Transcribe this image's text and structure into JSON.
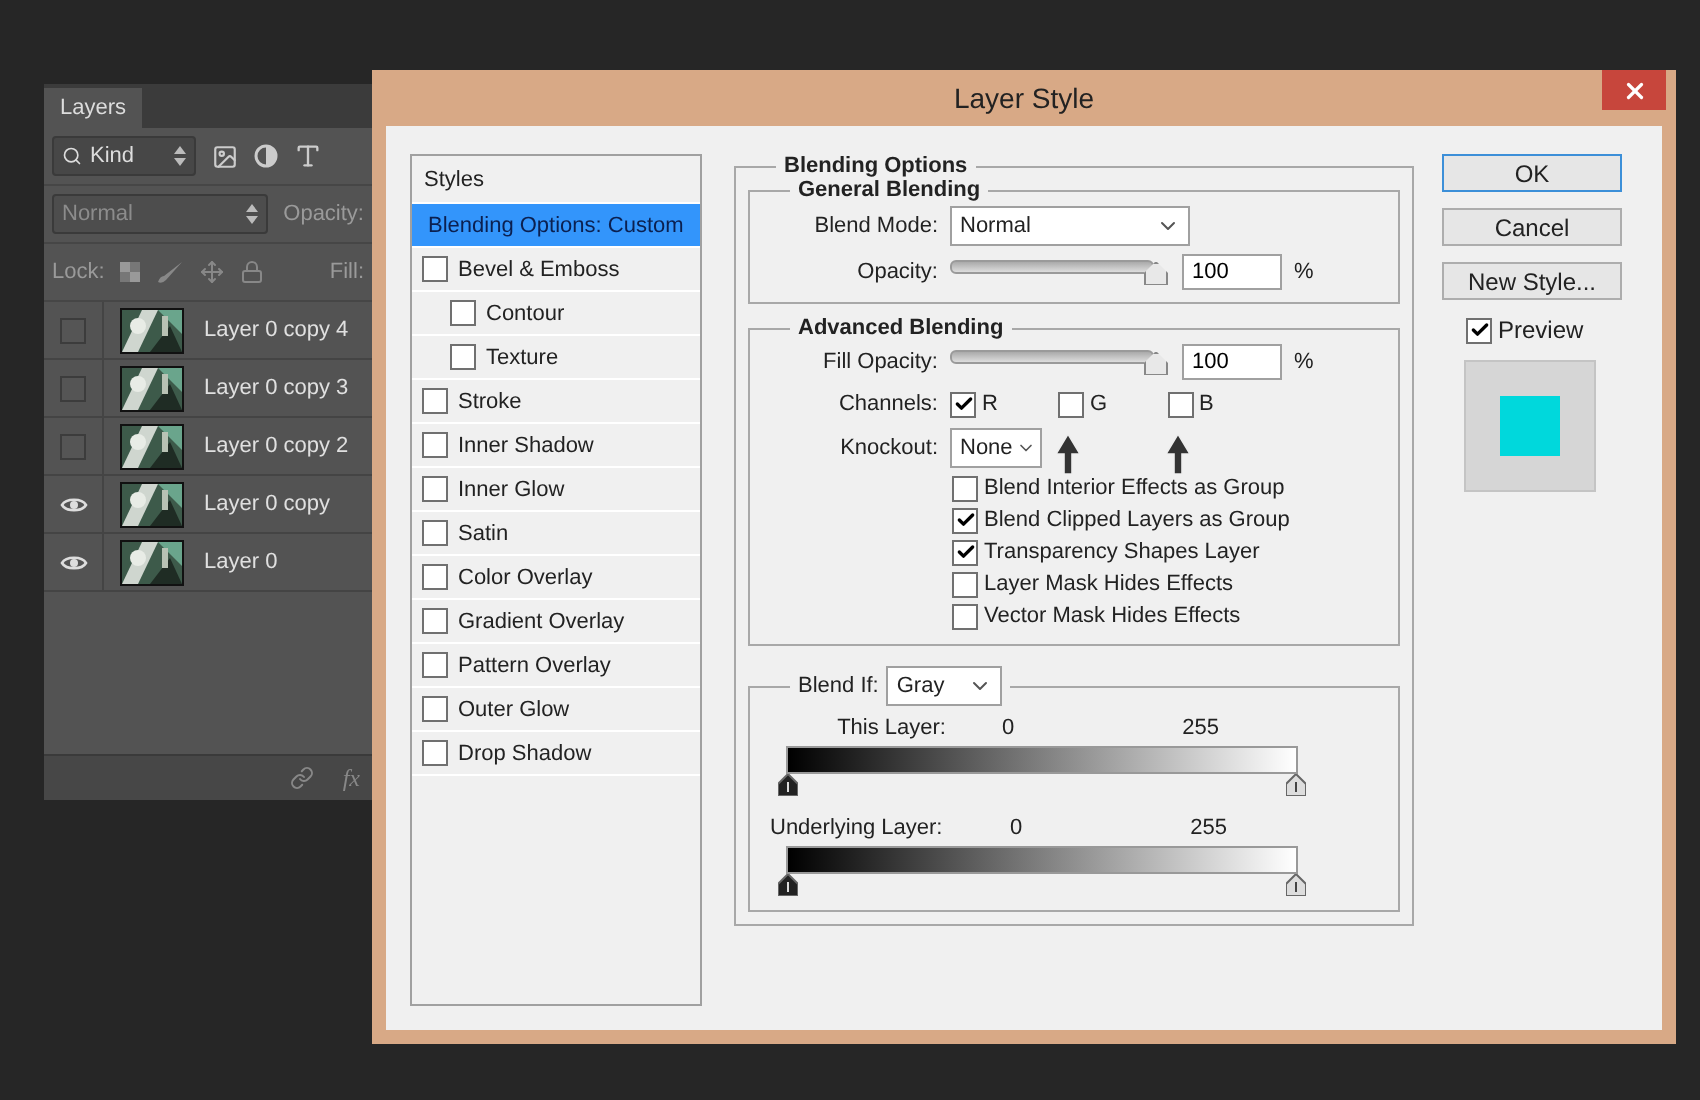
{
  "layers_panel": {
    "tab": "Layers",
    "filter": "Kind",
    "blend_mode": "Normal",
    "opacity_label": "Opacity:",
    "lock_label": "Lock:",
    "fill_label": "Fill:",
    "fx_label": "fx",
    "layers": [
      {
        "name": "Layer 0 copy 4",
        "visible": false
      },
      {
        "name": "Layer 0 copy 3",
        "visible": false
      },
      {
        "name": "Layer 0 copy 2",
        "visible": false
      },
      {
        "name": "Layer 0 copy",
        "visible": true
      },
      {
        "name": "Layer 0",
        "visible": true
      }
    ]
  },
  "dialog": {
    "title": "Layer Style",
    "styles_header": "Styles",
    "styles": [
      {
        "label": "Blending Options: Custom",
        "kind": "plain",
        "selected": true
      },
      {
        "label": "Bevel & Emboss",
        "kind": "check",
        "checked": false,
        "selected": false,
        "children": [
          {
            "label": "Contour",
            "kind": "check",
            "checked": false,
            "selected": false
          },
          {
            "label": "Texture",
            "kind": "check",
            "checked": false,
            "selected": false
          }
        ]
      },
      {
        "label": "Stroke",
        "kind": "check",
        "checked": false,
        "selected": false
      },
      {
        "label": "Inner Shadow",
        "kind": "check",
        "checked": false,
        "selected": false
      },
      {
        "label": "Inner Glow",
        "kind": "check",
        "checked": false,
        "selected": false
      },
      {
        "label": "Satin",
        "kind": "check",
        "checked": false,
        "selected": false
      },
      {
        "label": "Color Overlay",
        "kind": "check",
        "checked": false,
        "selected": false
      },
      {
        "label": "Gradient Overlay",
        "kind": "check",
        "checked": false,
        "selected": false
      },
      {
        "label": "Pattern Overlay",
        "kind": "check",
        "checked": false,
        "selected": false
      },
      {
        "label": "Outer Glow",
        "kind": "check",
        "checked": false,
        "selected": false
      },
      {
        "label": "Drop Shadow",
        "kind": "check",
        "checked": false,
        "selected": false
      }
    ],
    "blending_options": {
      "title": "Blending Options",
      "general": {
        "title": "General Blending",
        "blend_mode_label": "Blend Mode:",
        "blend_mode": "Normal",
        "opacity_label": "Opacity:",
        "opacity": {
          "level": 1
        },
        "opacity_value": "100",
        "unit": "%"
      },
      "advanced": {
        "title": "Advanced Blending",
        "fill_label": "Fill Opacity:",
        "fill_opacity": {
          "level": 1
        },
        "fill_value": "100",
        "unit": "%",
        "channels_label": "Channels:",
        "channels": [
          {
            "label": "R",
            "checked": true
          },
          {
            "label": "G",
            "checked": false
          },
          {
            "label": "B",
            "checked": false
          }
        ],
        "knockout_label": "Knockout:",
        "knockout": "None",
        "options": [
          {
            "label": "Blend Interior Effects as Group",
            "checked": false
          },
          {
            "label": "Blend Clipped Layers as Group",
            "checked": true
          },
          {
            "label": "Transparency Shapes Layer",
            "checked": true
          },
          {
            "label": "Layer Mask Hides Effects",
            "checked": false
          },
          {
            "label": "Vector Mask Hides Effects",
            "checked": false
          }
        ]
      },
      "blend_if": {
        "label": "Blend If:",
        "value": "Gray",
        "ranges": [
          {
            "label": "This Layer:",
            "low": "0",
            "high": "255"
          },
          {
            "label": "Underlying Layer:",
            "low": "0",
            "high": "255"
          }
        ]
      }
    },
    "buttons": [
      {
        "label": "OK",
        "default": true
      },
      {
        "label": "Cancel",
        "default": false
      },
      {
        "label": "New Style...",
        "default": false
      }
    ],
    "preview": {
      "label": "Preview",
      "checked": true
    }
  }
}
